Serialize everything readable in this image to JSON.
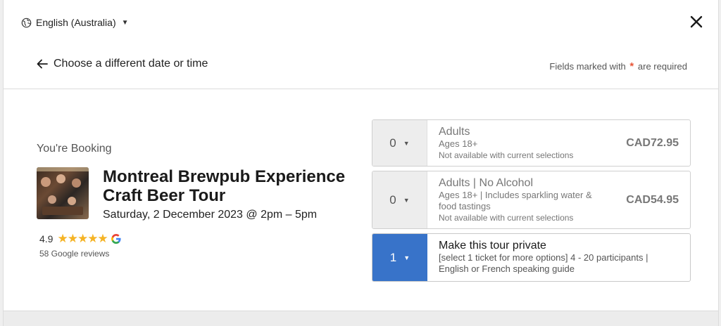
{
  "header": {
    "language": "English (Australia)",
    "back_label": "Choose a different date or time",
    "required_prefix": "Fields marked with",
    "required_star": "*",
    "required_suffix": "are required"
  },
  "booking": {
    "label": "You're Booking",
    "title": "Montreal Brewpub Experience Craft Beer Tour",
    "date": "Saturday, 2 December 2023 @ 2pm – 5pm",
    "rating": "4.9",
    "stars": "★★★★★",
    "reviews": "58 Google reviews"
  },
  "tickets": [
    {
      "qty": "0",
      "name": "Adults",
      "desc": "Ages 18+",
      "note": "Not available with current selections",
      "price": "CAD72.95"
    },
    {
      "qty": "0",
      "name": "Adults | No Alcohol",
      "desc": "Ages 18+ | Includes sparkling water & food tastings",
      "note": "Not available with current selections",
      "price": "CAD54.95"
    },
    {
      "qty": "1",
      "name": "Make this tour private",
      "desc": "[select 1 ticket for more options] 4 - 20 participants | English or French speaking guide",
      "note": "",
      "price": ""
    }
  ],
  "colors": {
    "selected_qty": "#3873c9",
    "required_star": "#e8573a",
    "stars": "#f5b324"
  },
  "icons": {
    "language": "globe-icon",
    "close": "close-icon",
    "back": "arrow-left-icon",
    "dropdown": "caret-down-icon",
    "google": "google-icon"
  }
}
